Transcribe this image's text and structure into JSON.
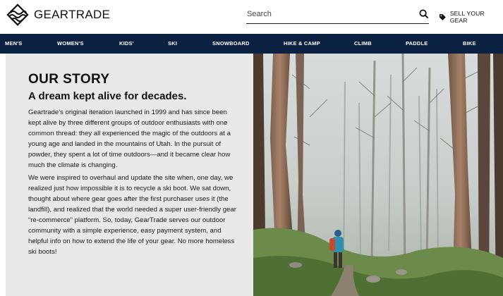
{
  "header": {
    "logo_text": "GEARTRADE",
    "search_placeholder": "Search",
    "sell_label": "SELL YOUR GEAR"
  },
  "nav": {
    "items": [
      "MEN'S",
      "WOMEN'S",
      "KIDS'",
      "SKI",
      "SNOWBOARD",
      "HIKE & CAMP",
      "CLIMB",
      "PADDLE",
      "BIKE"
    ]
  },
  "story": {
    "title": "OUR STORY",
    "subtitle": "A dream kept alive for decades.",
    "paragraph1": "Geartrade's original iteration launched in 1999 and has since been kept alive by three different groups of outdoor enthusiasts with one common thread: they all experienced the magic of the outdoors at a young age and landed in the mountains of Utah. In the pursuit of powder, they spent a lot of time outdoors—and it became clear how much the climate is changing.",
    "paragraph2": "We were inspired to overhaul and update the site when, one day, we realized just how impossible it is to recycle a ski boot. We sat down, thought about where gear goes after the first purchaser uses it (the landfill), and realized that the world needed a super user-friendly gear “re-commerce” platform. So, today, GearTrade serves our outdoor community with a simple experience, easy payment system, and helpful info on how to extend the life of your gear. No more homeless ski boots!"
  },
  "colors": {
    "nav_bg": "#0b2142",
    "panel_bg": "#e9e9e7",
    "text": "#111111"
  }
}
